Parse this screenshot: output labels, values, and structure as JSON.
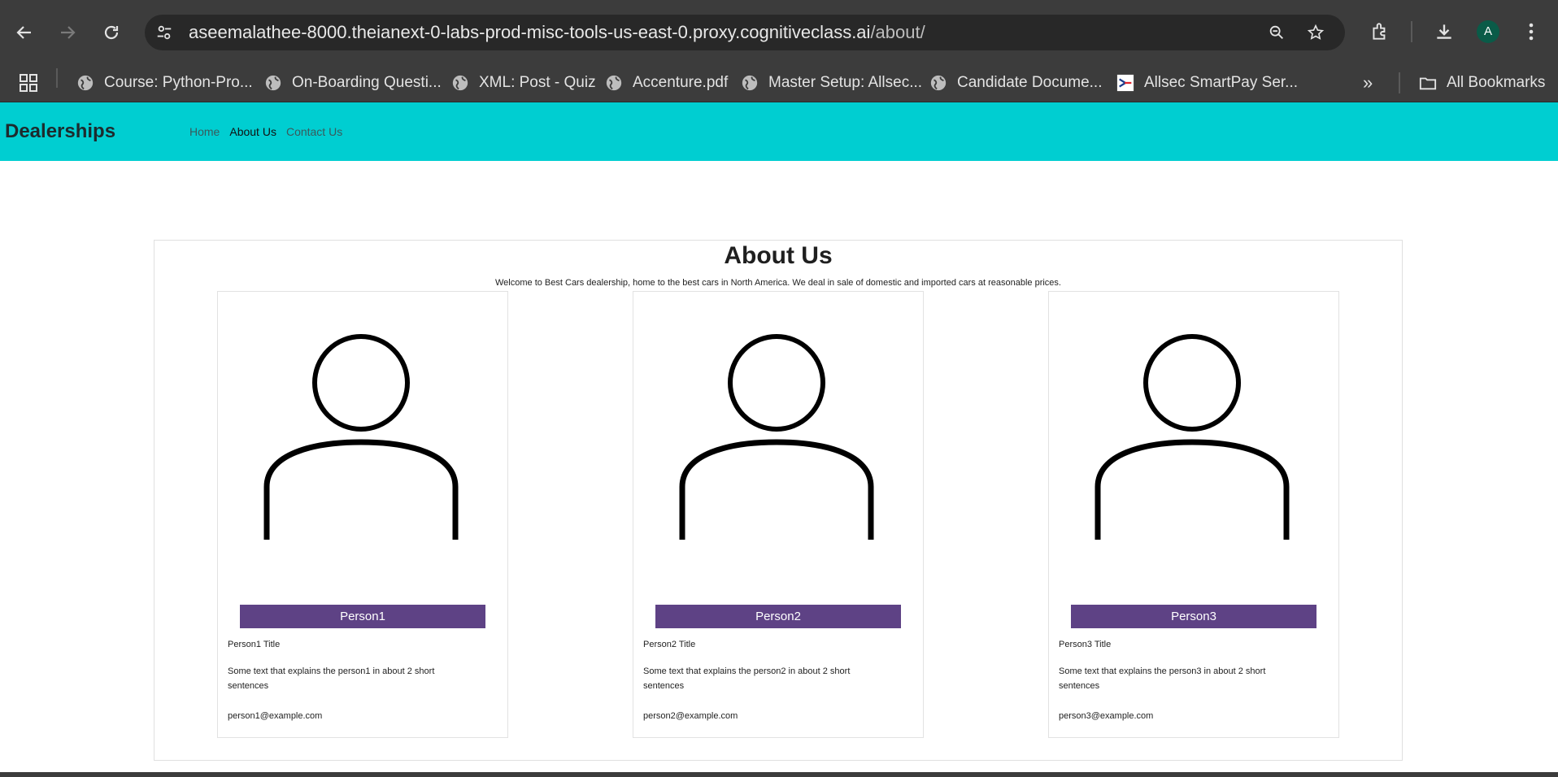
{
  "browser": {
    "url_host": "aseemalathee-8000.theianext-0-labs-prod-misc-tools-us-east-0.proxy.cognitiveclass.ai",
    "url_path": "/about/",
    "profile_initial": "A",
    "bookmarks": [
      "Course: Python-Pro...",
      "On-Boarding Questi...",
      "XML: Post - Quiz",
      "Accenture.pdf",
      "Master Setup: Allsec...",
      "Candidate Docume...",
      "Allsec SmartPay Ser..."
    ],
    "overflow_label": "»",
    "all_bookmarks": "All Bookmarks"
  },
  "navbar": {
    "brand": "Dealerships",
    "links": [
      "Home",
      "About Us",
      "Contact Us"
    ]
  },
  "about": {
    "title": "About Us",
    "subtitle": "Welcome to Best Cars dealership, home to the best cars in North America. We deal in sale of domestic and imported cars at reasonable prices."
  },
  "people": [
    {
      "name": "Person1",
      "title": "Person1 Title",
      "description": "Some text that explains the person1 in about 2 short sentences",
      "email": "person1@example.com"
    },
    {
      "name": "Person2",
      "title": "Person2 Title",
      "description": "Some text that explains the person2 in about 2 short sentences",
      "email": "person2@example.com"
    },
    {
      "name": "Person3",
      "title": "Person3 Title",
      "description": "Some text that explains the person3 in about 2 short sentences",
      "email": "person3@example.com"
    }
  ],
  "colors": {
    "navbar": "#00ced1",
    "name_bar": "#5e4285",
    "chrome": "#3c3c3c"
  }
}
